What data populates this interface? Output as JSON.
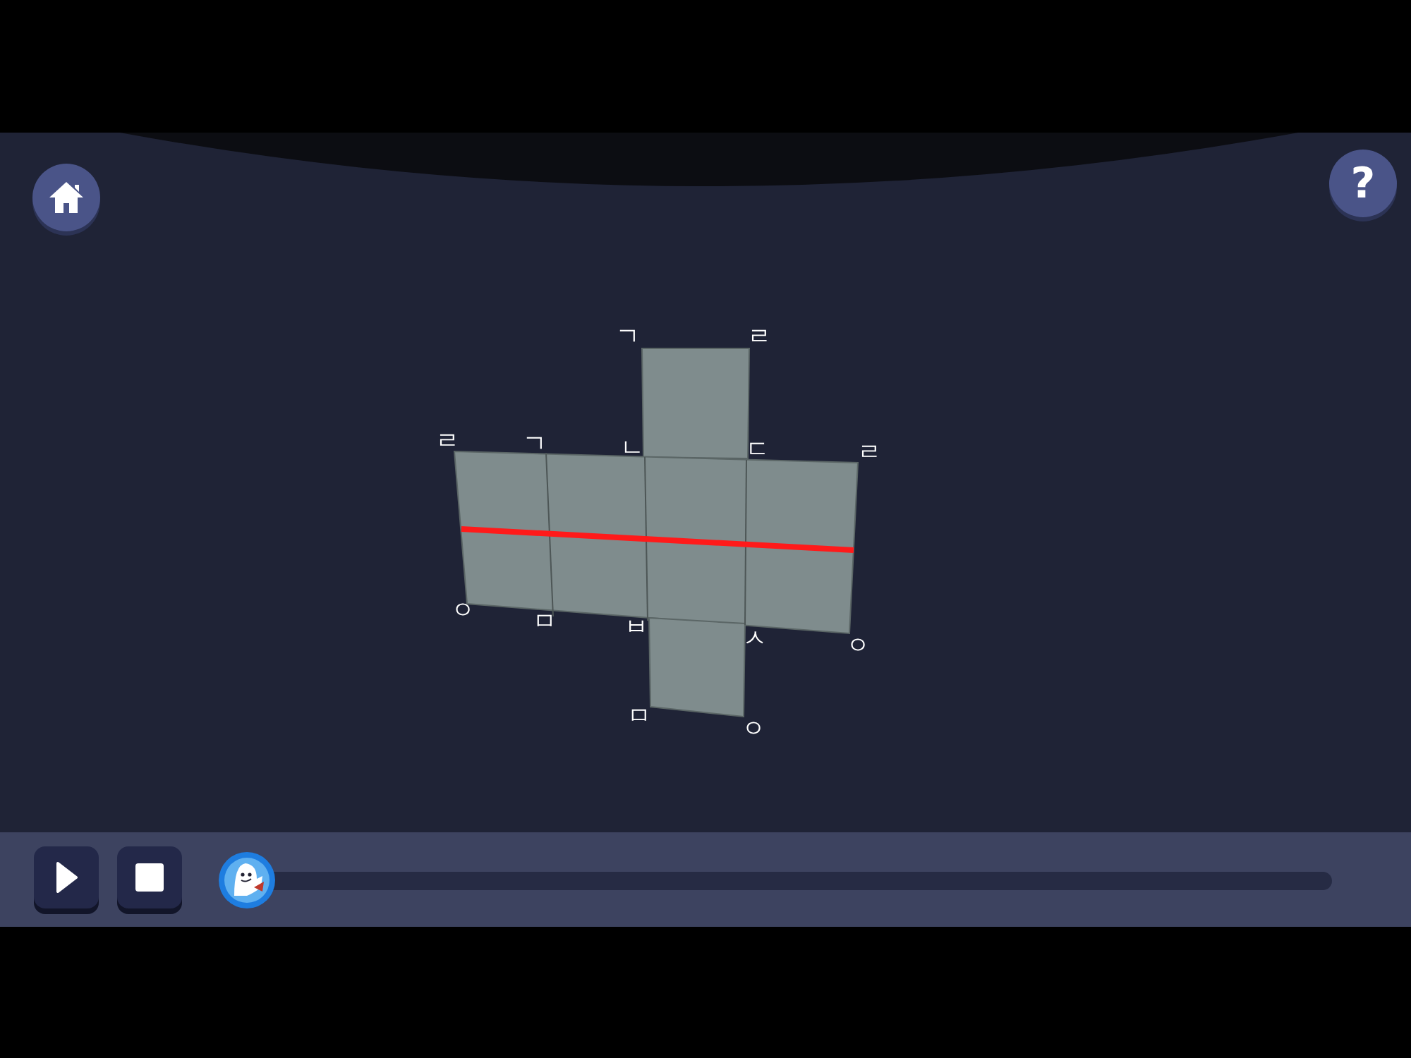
{
  "toolbar": {
    "help_label": "?"
  },
  "net": {
    "vertex_labels": [
      "ㄱ",
      "ㄹ",
      "ㄹ",
      "ㄱ",
      "ㄴ",
      "ㄷ",
      "ㄹ",
      "ㅇ",
      "ㅁ",
      "ㅂ",
      "ㅅ",
      "ㅇ",
      "ㅁ",
      "ㅇ"
    ],
    "cut_line": true
  },
  "player": {
    "playing": false,
    "level": 0
  }
}
